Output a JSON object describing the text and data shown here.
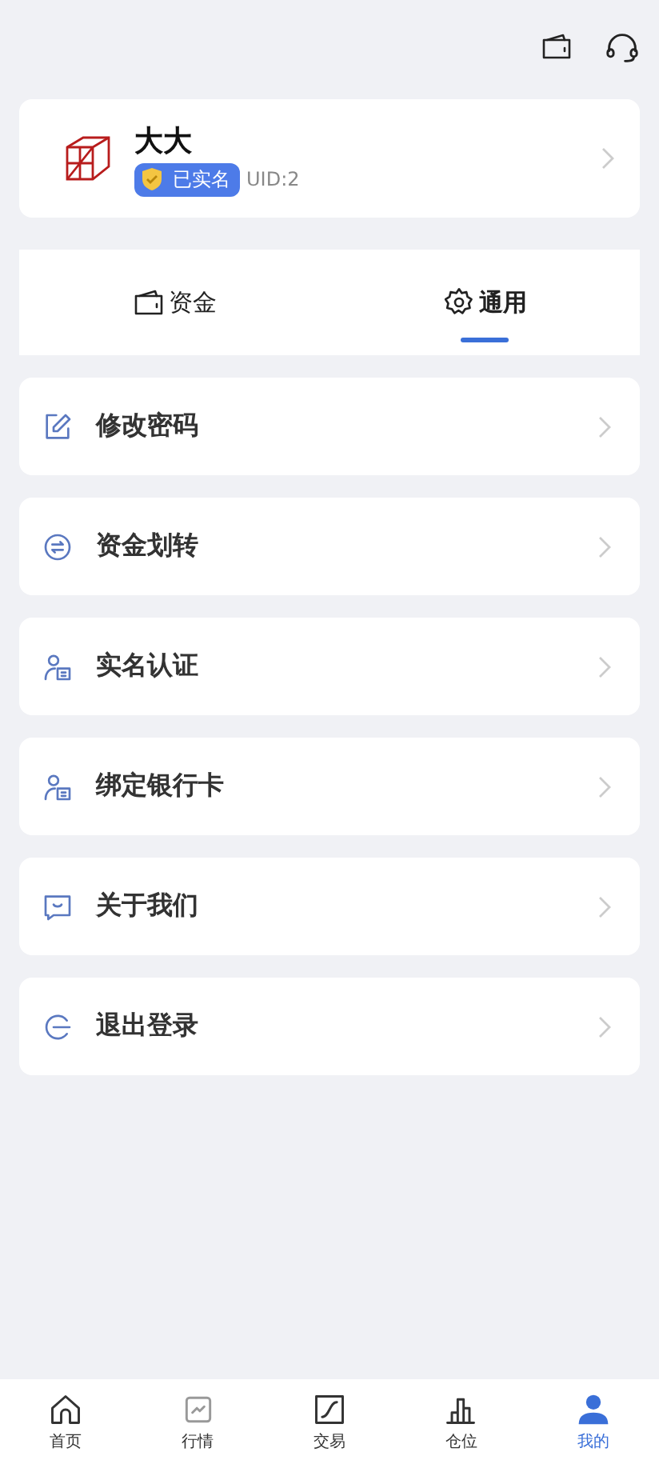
{
  "profile": {
    "name": "大大",
    "verified_badge": "已实名",
    "uid": "UID:2"
  },
  "tabs": [
    {
      "label": "资金",
      "kind": "wallet",
      "selected": false
    },
    {
      "label": "通用",
      "kind": "gear",
      "selected": true
    }
  ],
  "menu": [
    {
      "label": "修改密码",
      "kind": "edit"
    },
    {
      "label": "资金划转",
      "kind": "transfer"
    },
    {
      "label": "实名认证",
      "kind": "id"
    },
    {
      "label": "绑定银行卡",
      "kind": "id"
    },
    {
      "label": "关于我们",
      "kind": "chat"
    },
    {
      "label": "退出登录",
      "kind": "logout"
    }
  ],
  "bottom_nav": [
    {
      "label": "首页",
      "kind": "home",
      "selected": false
    },
    {
      "label": "行情",
      "kind": "market",
      "selected": false
    },
    {
      "label": "交易",
      "kind": "trade",
      "selected": false
    },
    {
      "label": "仓位",
      "kind": "bars",
      "selected": false
    },
    {
      "label": "我的",
      "kind": "user",
      "selected": true
    }
  ]
}
